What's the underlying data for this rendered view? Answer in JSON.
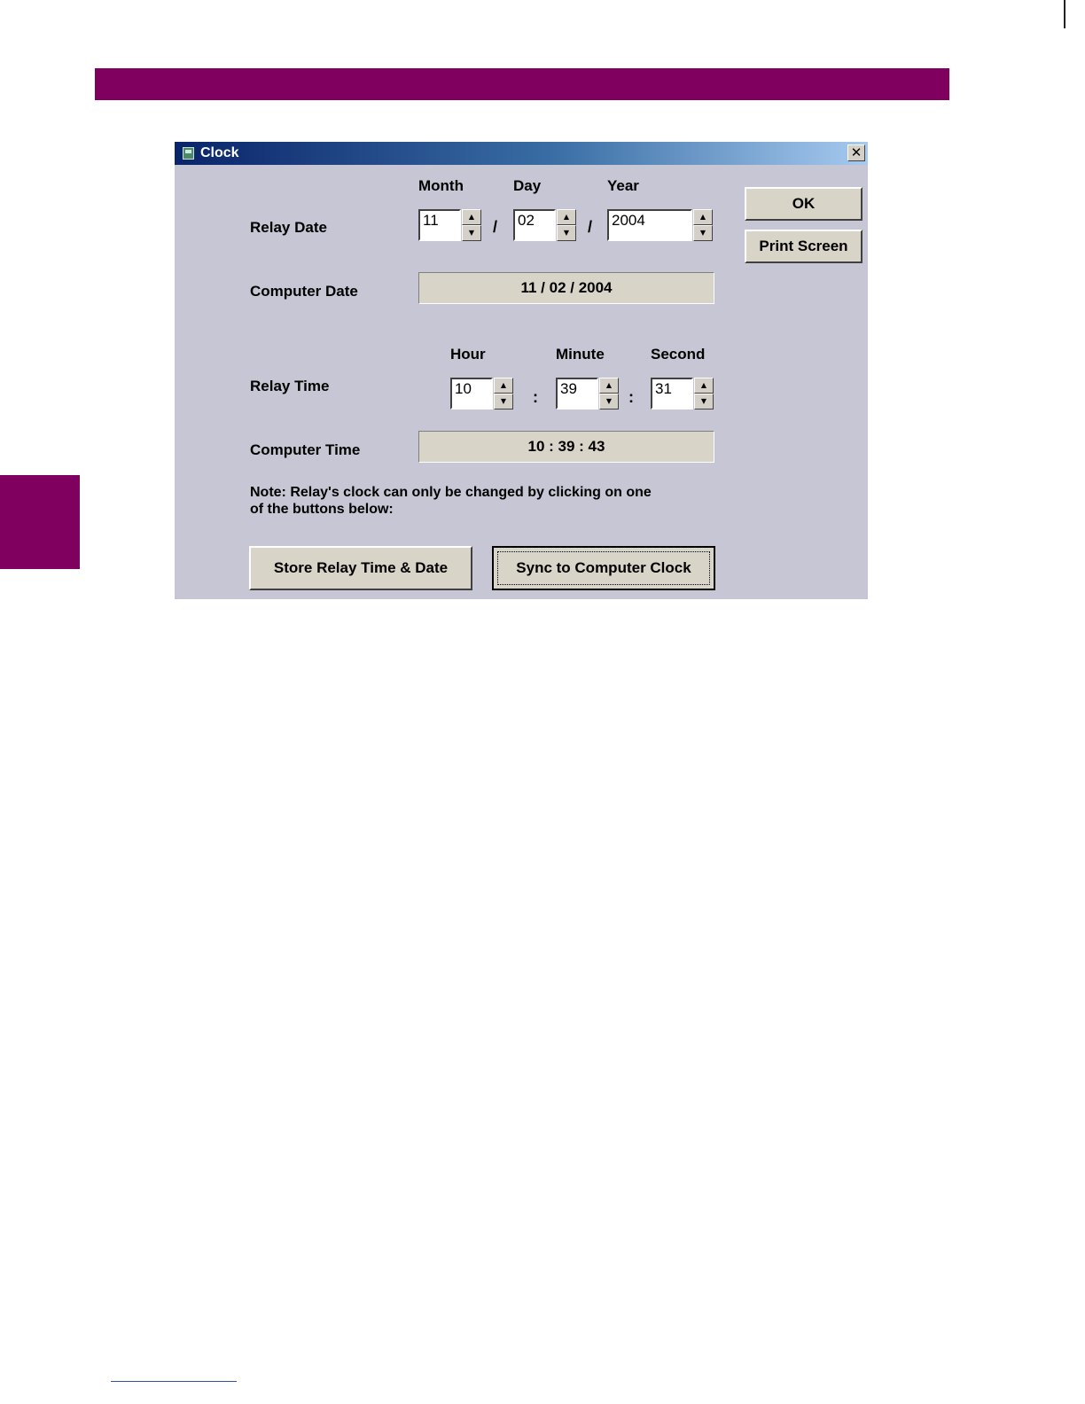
{
  "window": {
    "title": "Clock",
    "close_glyph": "✕"
  },
  "date": {
    "label": "Relay Date",
    "headers": {
      "month": "Month",
      "day": "Day",
      "year": "Year"
    },
    "month": "11",
    "day": "02",
    "year": "2004",
    "separator": "/"
  },
  "computer_date": {
    "label": "Computer Date",
    "value": "11 / 02 / 2004"
  },
  "time": {
    "label": "Relay Time",
    "headers": {
      "hour": "Hour",
      "minute": "Minute",
      "second": "Second"
    },
    "hour": "10",
    "minute": "39",
    "second": "31",
    "separator": ":"
  },
  "computer_time": {
    "label": "Computer Time",
    "value": "10 : 39 : 43"
  },
  "note": {
    "line1": "Note: Relay's clock can only be changed by clicking on one",
    "line2": "of the buttons below:"
  },
  "buttons": {
    "ok": "OK",
    "print_screen": "Print Screen",
    "store": "Store Relay Time & Date",
    "sync": "Sync to Computer Clock"
  },
  "spin": {
    "up": "▲",
    "down": "▼"
  },
  "colors": {
    "accent": "#7f005f",
    "dialog_bg": "#c6c6d4",
    "button_face": "#d8d4c8"
  }
}
